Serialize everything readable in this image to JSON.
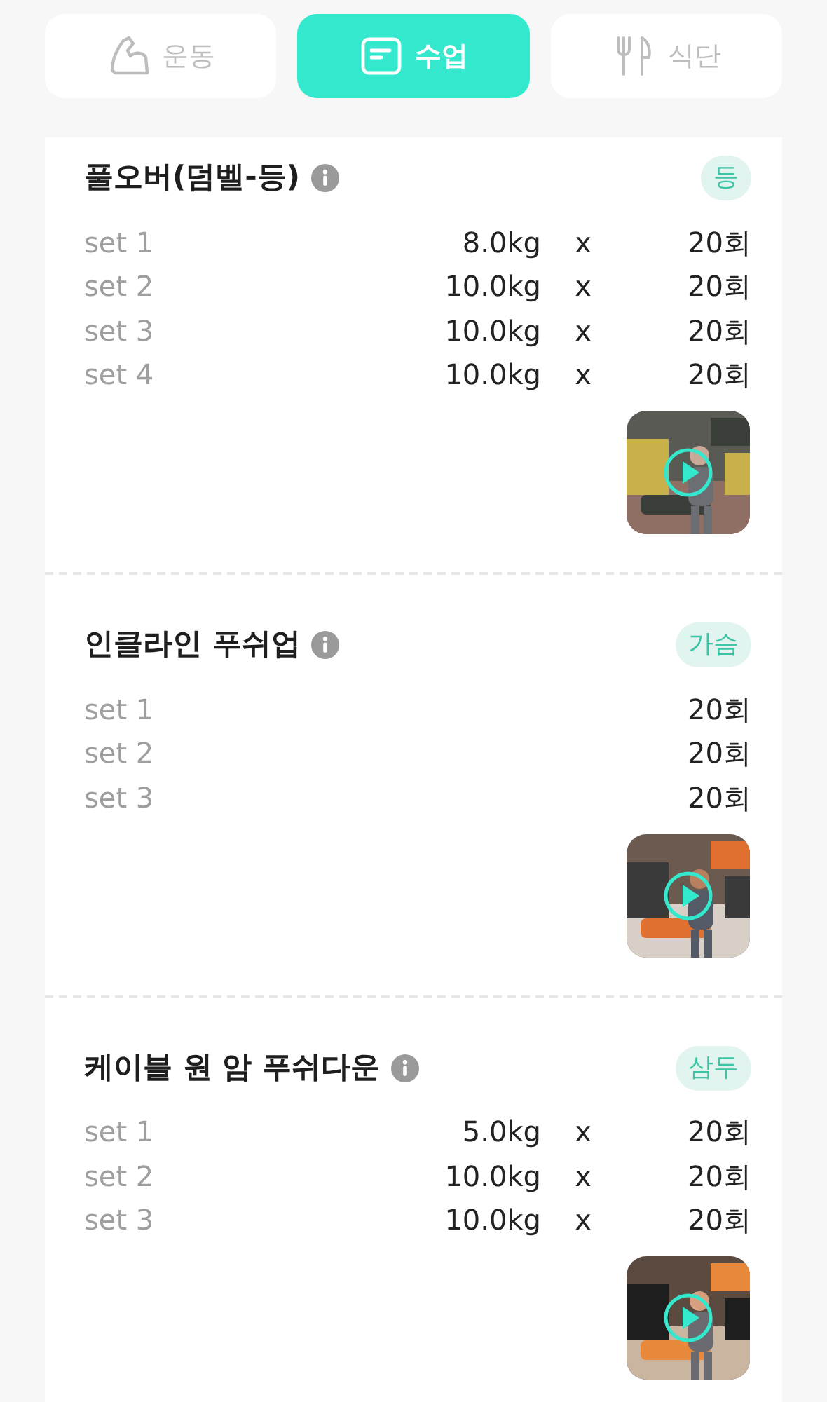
{
  "tabs": [
    {
      "label": "운동",
      "selected": false
    },
    {
      "label": "수업",
      "selected": true
    },
    {
      "label": "식단",
      "selected": false
    }
  ],
  "exercises": [
    {
      "name": "풀오버(덤벨-등)",
      "tag": "등",
      "sets": [
        {
          "label": "set 1",
          "weight": "8.0kg",
          "times": "x",
          "reps": "20회"
        },
        {
          "label": "set 2",
          "weight": "10.0kg",
          "times": "x",
          "reps": "20회"
        },
        {
          "label": "set 3",
          "weight": "10.0kg",
          "times": "x",
          "reps": "20회"
        },
        {
          "label": "set 4",
          "weight": "10.0kg",
          "times": "x",
          "reps": "20회"
        }
      ],
      "video": {
        "kind": "picture"
      }
    },
    {
      "name": "인클라인 푸쉬업",
      "tag": "가슴",
      "sets": [
        {
          "label": "set 1",
          "reps": "20회"
        },
        {
          "label": "set 2",
          "reps": "20회"
        },
        {
          "label": "set 3",
          "reps": "20회"
        }
      ],
      "video": {
        "kind": "picture"
      }
    },
    {
      "name": "케이블 원 암 푸쉬다운",
      "tag": "삼두",
      "sets": [
        {
          "label": "set 1",
          "weight": "5.0kg",
          "times": "x",
          "reps": "20회"
        },
        {
          "label": "set 2",
          "weight": "10.0kg",
          "times": "x",
          "reps": "20회"
        },
        {
          "label": "set 3",
          "weight": "10.0kg",
          "times": "x",
          "reps": "20회"
        }
      ],
      "video": {
        "kind": "picture"
      }
    }
  ]
}
